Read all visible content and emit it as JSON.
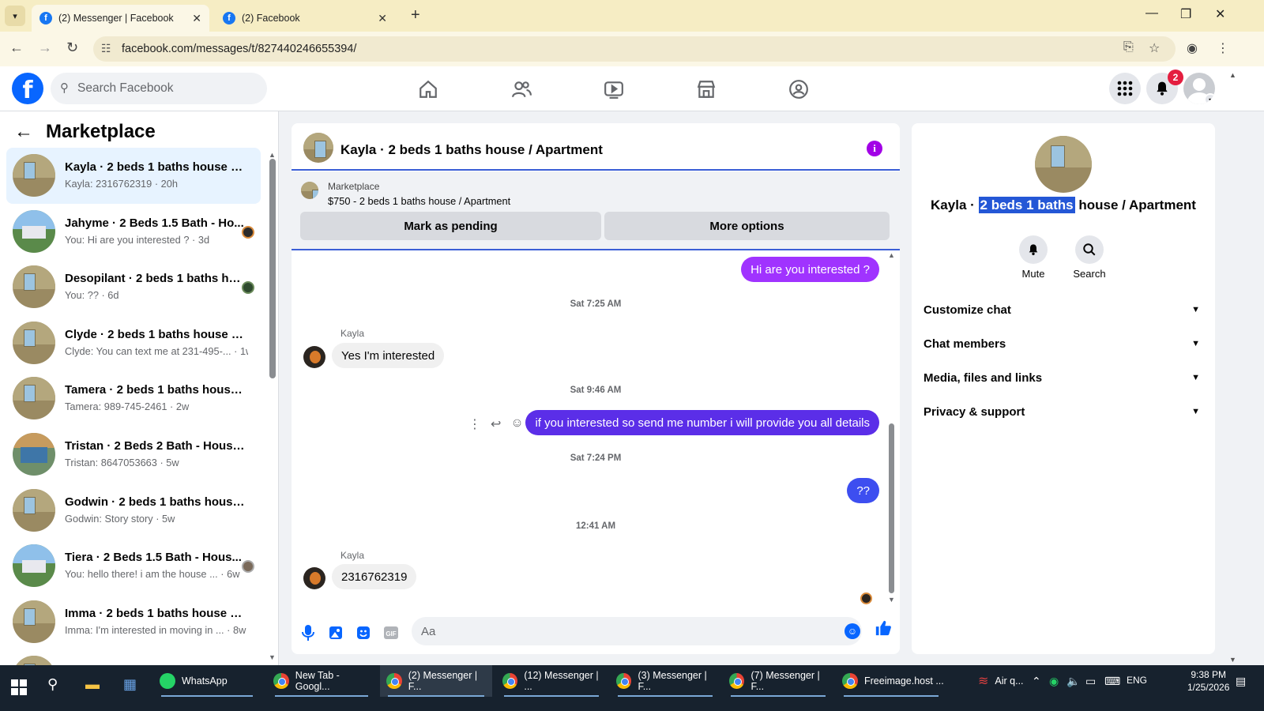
{
  "browser": {
    "tabs": [
      {
        "label": "(2) Messenger | Facebook",
        "active": true
      },
      {
        "label": "(2) Facebook",
        "active": false
      }
    ],
    "url": "facebook.com/messages/t/827440246655394/"
  },
  "fb_header": {
    "search_placeholder": "Search Facebook",
    "notification_count": "2",
    "nav_icons": [
      "home-icon",
      "friends-icon",
      "video-icon",
      "marketplace-icon",
      "groups-icon"
    ]
  },
  "sidebar": {
    "title": "Marketplace",
    "conversations": [
      {
        "title": "Kayla · 2 beds 1 baths house / A...",
        "preview": "Kayla: 2316762319 · 20h",
        "thumb": "room",
        "active": true
      },
      {
        "title": "Jahyme · 2 Beds 1.5 Bath - Ho...",
        "preview": "You: Hi are you interested ? · 3d",
        "thumb": "outdoor",
        "seen": true
      },
      {
        "title": "Desopilant · 2 beds 1 baths ho...",
        "preview": "You: ?? · 6d",
        "thumb": "room",
        "seen": true
      },
      {
        "title": "Clyde · 2 beds 1 baths house / A...",
        "preview": "Clyde: You can text me at 231-495-... · 1w",
        "thumb": "room"
      },
      {
        "title": "Tamera · 2 beds 1 baths house / ...",
        "preview": "Tamera: 989-745-2461 · 2w",
        "thumb": "room"
      },
      {
        "title": "Tristan · 2 Beds 2 Bath - House f...",
        "preview": "Tristan: 8647053663 · 5w",
        "thumb": "bluehouse"
      },
      {
        "title": "Godwin · 2 beds 1 baths house / ...",
        "preview": "Godwin: Story story · 5w",
        "thumb": "room"
      },
      {
        "title": "Tiera · 2 Beds 1.5 Bath - Hous...",
        "preview": "You: hello there! i am the house ... · 6w",
        "thumb": "outdoor",
        "seen": true
      },
      {
        "title": "Imma · 2 beds 1 baths house / A...",
        "preview": "Imma: I'm interested in moving in ... · 8w",
        "thumb": "room"
      },
      {
        "title": "",
        "preview": "",
        "thumb": "room"
      }
    ]
  },
  "chat": {
    "title": "Kayla · 2 beds 1 baths house / Apartment",
    "marketplace_label": "Marketplace",
    "listing": "$750 - 2 beds 1 baths house / Apartment",
    "mark_pending": "Mark as pending",
    "more_options": "More options",
    "messages": {
      "m1": "Hi are you interested ?",
      "t1": "Sat 7:25 AM",
      "sender1": "Kayla",
      "m2": "Yes I'm interested",
      "t2": "Sat 9:46 AM",
      "m3": "if you interested so send me number i will provide you all details",
      "t3": "Sat 7:24 PM",
      "m4": "??",
      "t4": "12:41 AM",
      "sender2": "Kayla",
      "m5": "2316762319"
    },
    "composer_placeholder": "Aa",
    "colors": {
      "outgoing_1": "#a033ff",
      "outgoing_2": "#5b2ee8",
      "outgoing_3": "#3d4ef0"
    }
  },
  "details": {
    "title_pre": "Kayla · ",
    "title_highlight": "2 beds 1 baths",
    "title_post": " house / Apartment",
    "mute": "Mute",
    "search": "Search",
    "sections": [
      "Customize chat",
      "Chat members",
      "Media, files and links",
      "Privacy & support"
    ]
  },
  "taskbar": {
    "apps": [
      {
        "label": "WhatsApp"
      },
      {
        "label": "New Tab - Googl..."
      },
      {
        "label": "(2) Messenger | F..."
      },
      {
        "label": "(12) Messenger | ..."
      },
      {
        "label": "(3) Messenger | F..."
      },
      {
        "label": "(7) Messenger | F..."
      },
      {
        "label": "Freeimage.host ..."
      },
      {
        "label": "Air q..."
      }
    ],
    "language": "ENG",
    "time": "9:38 PM",
    "date": "1/25/2026"
  }
}
